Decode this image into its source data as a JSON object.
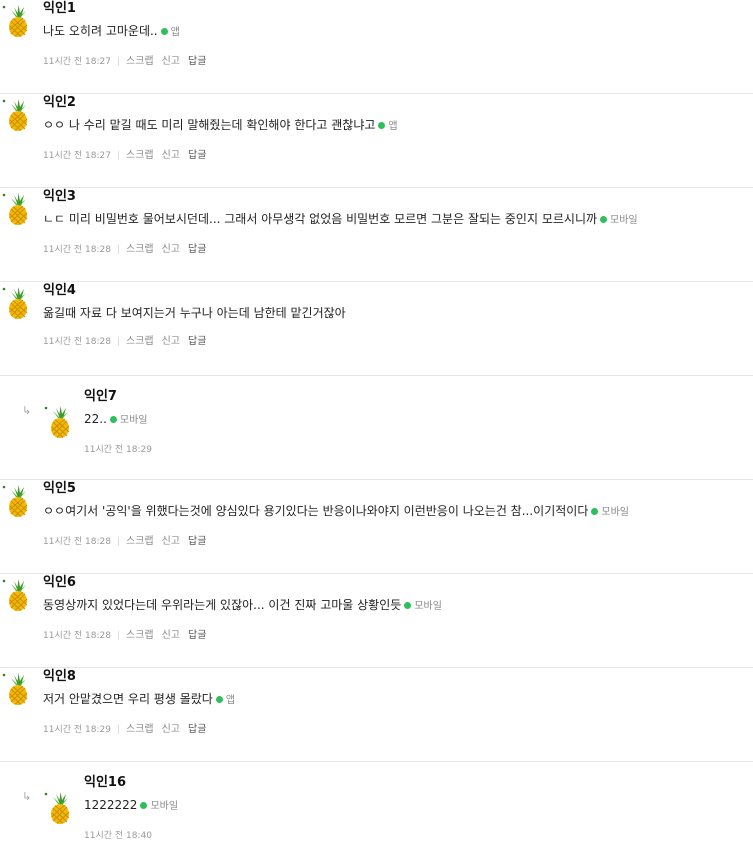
{
  "comments": [
    {
      "name": "익인1",
      "text": "나도 오히려 고마운데..",
      "device": "앱",
      "time": "11시간 전 18:27",
      "reply": false
    },
    {
      "name": "익인2",
      "text": "ㅇㅇ 나 수리 맡길 때도 미리 말해줬는데 확인해야 한다고 괜찮냐고",
      "device": "앱",
      "time": "11시간 전 18:27",
      "reply": false
    },
    {
      "name": "익인3",
      "text": "ㄴㄷ 미리 비밀번호 물어보시던데... 그래서 아무생각 없었음 비밀번호 모르면 그분은 잘되는 중인지 모르시니까",
      "device": "모바일",
      "time": "11시간 전 18:28",
      "reply": false
    },
    {
      "name": "익인4",
      "text": "옮길때 자료 다 보여지는거 누구나 아는데 남한테 맡긴거잖아",
      "device": "",
      "time": "11시간 전 18:28",
      "reply": false
    },
    {
      "name": "익인7",
      "text": "22..",
      "device": "모바일",
      "time": "11시간 전 18:29",
      "reply": true
    },
    {
      "name": "익인5",
      "text": "ㅇㅇ여기서 '공익'을 위했다는것에 양심있다 용기있다는 반응이나와야지 이런반응이 나오는건 참...이기적이다",
      "device": "모바일",
      "time": "11시간 전 18:28",
      "reply": false
    },
    {
      "name": "익인6",
      "text": "동영상까지 있었다는데 우위라는게 있잖아... 이건 진짜 고마울 상황인듯",
      "device": "모바일",
      "time": "11시간 전 18:28",
      "reply": false
    },
    {
      "name": "익인8",
      "text": "저거 안맡겼으면 우리 평생 몰랐다",
      "device": "앱",
      "time": "11시간 전 18:29",
      "reply": false
    },
    {
      "name": "익인16",
      "text": "1222222",
      "device": "모바일",
      "time": "11시간 전 18:40",
      "reply": true
    }
  ],
  "actions": {
    "scrap": "스크랩",
    "report": "신고",
    "reply": "답글"
  },
  "icons": {
    "avatar": "pineapple-icon",
    "reply_arrow": "reply-arrow-icon",
    "device_dot": "device-dot-icon"
  },
  "colors": {
    "device_dot": "#2cbf5c",
    "separator": "#e6e6e6"
  }
}
